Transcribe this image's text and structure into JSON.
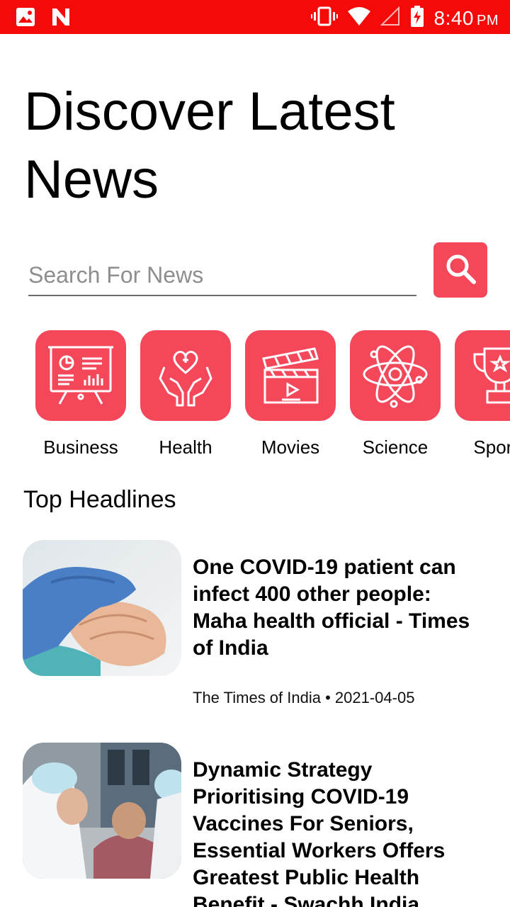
{
  "status_bar": {
    "time": "8:40",
    "ampm": "PM",
    "icons": [
      "image-icon",
      "app-n-icon",
      "vibrate-icon",
      "wifi-icon",
      "signal-icon",
      "battery-charging-icon"
    ]
  },
  "title": "Discover Latest News",
  "search": {
    "placeholder": "Search For News",
    "value": "",
    "button_icon": "search-icon"
  },
  "categories": [
    {
      "label": "Business",
      "icon": "presentation-board-icon"
    },
    {
      "label": "Health",
      "icon": "heart-hands-icon"
    },
    {
      "label": "Movies",
      "icon": "clapperboard-icon"
    },
    {
      "label": "Science",
      "icon": "atom-icon"
    },
    {
      "label": "Sports",
      "icon": "trophy-icon"
    }
  ],
  "section_title": "Top Headlines",
  "articles": [
    {
      "headline": "One COVID-19 patient can infect 400 other people: Maha health official - Times of India",
      "source": "The Times of India",
      "date": "2021-04-05",
      "meta": "The Times of India • 2021-04-05"
    },
    {
      "headline": "Dynamic Strategy Prioritising COVID-19 Vaccines For Seniors, Essential Workers Offers Greatest Public Health Benefit - Swachh India",
      "source": "",
      "date": "",
      "meta": ""
    }
  ],
  "colors": {
    "status_bar": "#f50a0a",
    "accent": "#f5475a"
  }
}
